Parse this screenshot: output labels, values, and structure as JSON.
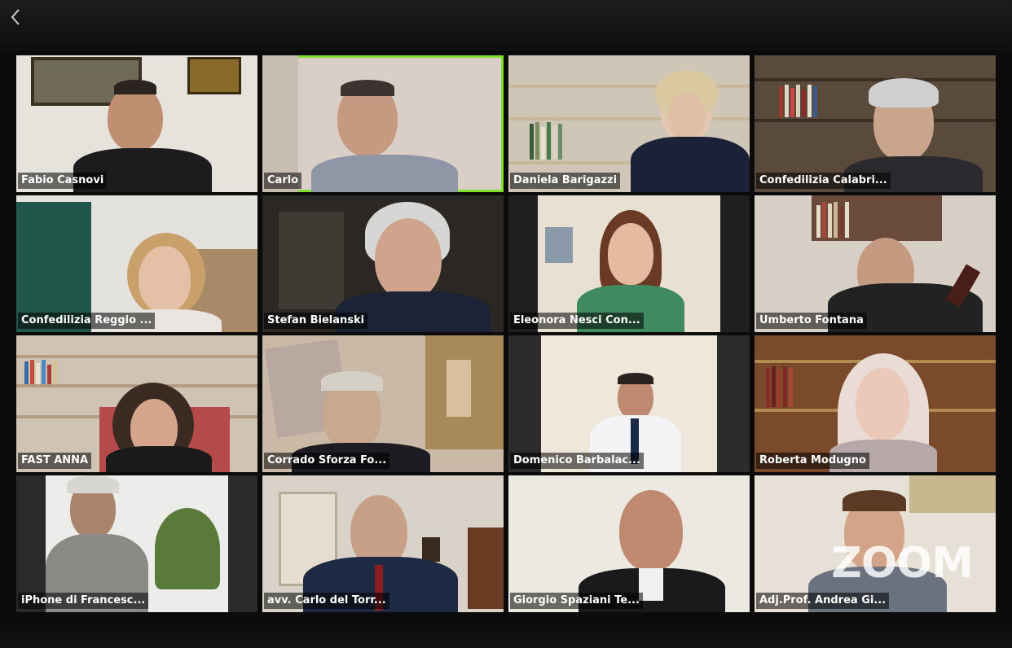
{
  "toolbar": {
    "back_icon": "chevron-left-icon"
  },
  "participants": [
    {
      "name": "Fabio Casnovi",
      "active": false
    },
    {
      "name": "Carlo",
      "active": true
    },
    {
      "name": "Daniela Barigazzi",
      "active": false
    },
    {
      "name": "Confedilizia Calabri...",
      "active": false
    },
    {
      "name": "Confedilizia Reggio ...",
      "active": false
    },
    {
      "name": "Stefan Bielanski",
      "active": false
    },
    {
      "name": "Eleonora Nesci Con...",
      "active": false
    },
    {
      "name": "Umberto Fontana",
      "active": false
    },
    {
      "name": "FAST ANNA",
      "active": false
    },
    {
      "name": "Corrado Sforza Fo...",
      "active": false
    },
    {
      "name": "Domenico Barbalac...",
      "active": false
    },
    {
      "name": "Roberta Modugno",
      "active": false
    },
    {
      "name": "iPhone di Francesc...",
      "active": false
    },
    {
      "name": "avv. Carlo del Torr...",
      "active": false
    },
    {
      "name": "Giorgio Spaziani Te...",
      "active": false
    },
    {
      "name": "Adj.Prof. Andrea Gi...",
      "active": false
    }
  ],
  "watermark": "ZOOM",
  "colors": {
    "active_speaker_border": "#7fe02a",
    "background": "#0d0d0d"
  }
}
